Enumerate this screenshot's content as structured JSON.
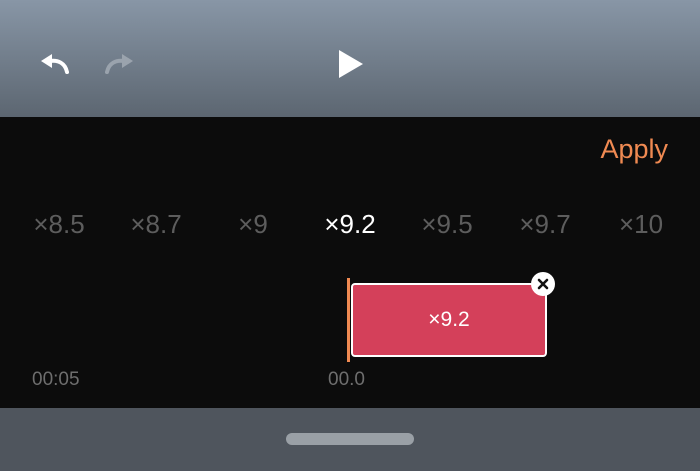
{
  "toolbar": {
    "undo_icon": "undo-icon",
    "redo_icon": "redo-icon",
    "play_icon": "play-icon"
  },
  "apply_label": "Apply",
  "speed_options": [
    {
      "label": "×8.5",
      "value": 8.5,
      "selected": false
    },
    {
      "label": "×8.7",
      "value": 8.7,
      "selected": false
    },
    {
      "label": "×9",
      "value": 9,
      "selected": false
    },
    {
      "label": "×9.2",
      "value": 9.2,
      "selected": true
    },
    {
      "label": "×9.5",
      "value": 9.5,
      "selected": false
    },
    {
      "label": "×9.7",
      "value": 9.7,
      "selected": false
    },
    {
      "label": "×10",
      "value": 10,
      "selected": false
    }
  ],
  "clip": {
    "label": "×9.2"
  },
  "timeline": {
    "start_time": "00:05",
    "current_time": "00.0"
  },
  "colors": {
    "accent": "#f08a52",
    "clip": "#d4405a",
    "selected_text": "#ffffff",
    "muted_text": "#5d5d5d"
  }
}
